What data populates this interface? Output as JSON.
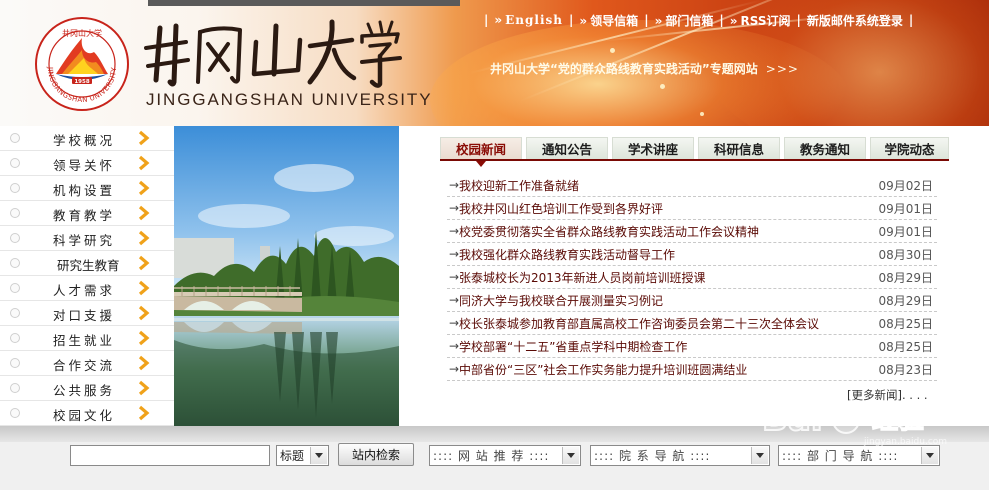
{
  "header": {
    "university_cn": "井冈山大学",
    "university_en": "JINGGANGSHAN UNIVERSITY",
    "logo_ring_text": "JINGGANGSHAN UNIVERSITY",
    "logo_year": "1958",
    "top_links": [
      {
        "label": "English"
      },
      {
        "label": "领导信箱"
      },
      {
        "label": "部门信箱"
      },
      {
        "label": "RSS订阅"
      },
      {
        "label": "新版邮件系统登录"
      }
    ],
    "link_prefix": "»",
    "separator": "|",
    "special_link": "井冈山大学“党的群众路线教育实践活动”专题网站",
    "special_arrows": ">>>"
  },
  "sidebar": {
    "items": [
      {
        "label": "学校概况"
      },
      {
        "label": "领导关怀"
      },
      {
        "label": "机构设置"
      },
      {
        "label": "教育教学"
      },
      {
        "label": "科学研究"
      },
      {
        "label": "研究生教育"
      },
      {
        "label": "人才需求"
      },
      {
        "label": "对口支援"
      },
      {
        "label": "招生就业"
      },
      {
        "label": "合作交流"
      },
      {
        "label": "公共服务"
      },
      {
        "label": "校园文化"
      }
    ]
  },
  "news": {
    "tabs": [
      {
        "label": "校园新闻",
        "active": true
      },
      {
        "label": "通知公告"
      },
      {
        "label": "学术讲座"
      },
      {
        "label": "科研信息"
      },
      {
        "label": "教务通知"
      },
      {
        "label": "学院动态"
      }
    ],
    "items": [
      {
        "title": "我校迎新工作准备就绪",
        "date": "09月02日"
      },
      {
        "title": "我校井冈山红色培训工作受到各界好评",
        "date": "09月01日"
      },
      {
        "title": "校党委贯彻落实全省群众路线教育实践活动工作会议精神",
        "date": "09月01日"
      },
      {
        "title": "我校强化群众路线教育实践活动督导工作",
        "date": "08月30日"
      },
      {
        "title": "张泰城校长为2013年新进人员岗前培训班授课",
        "date": "08月29日"
      },
      {
        "title": "同济大学与我校联合开展测量实习例记",
        "date": "08月29日"
      },
      {
        "title": "校长张泰城参加教育部直属高校工作咨询委员会第二十三次全体会议",
        "date": "08月25日"
      },
      {
        "title": "学校部署“十二五”省重点学科中期检查工作",
        "date": "08月25日"
      },
      {
        "title": "中部省份“三区”社会工作实务能力提升培训班圆满结业",
        "date": "08月23日"
      }
    ],
    "row_arrow": "→",
    "more": "[更多新闻]. . . ."
  },
  "search": {
    "input_value": "",
    "scope_select": "标题",
    "button_label": "站内检索",
    "site_recommend": ":::: 网 站 推 荐 ::::",
    "college_nav": ":::: 院 系 导 航 ::::",
    "dept_nav": ":::: 部 门 导 航 ::::"
  },
  "watermark": {
    "brand": "Bai",
    "paw": "du",
    "jingyan": "经验",
    "url": "jingyan.baidu.com"
  },
  "colors": {
    "accent_red": "#8a0c06",
    "news_title": "#5a0a05",
    "nav_chevron": "#f0a21a",
    "header_orange": "#e0581c"
  }
}
